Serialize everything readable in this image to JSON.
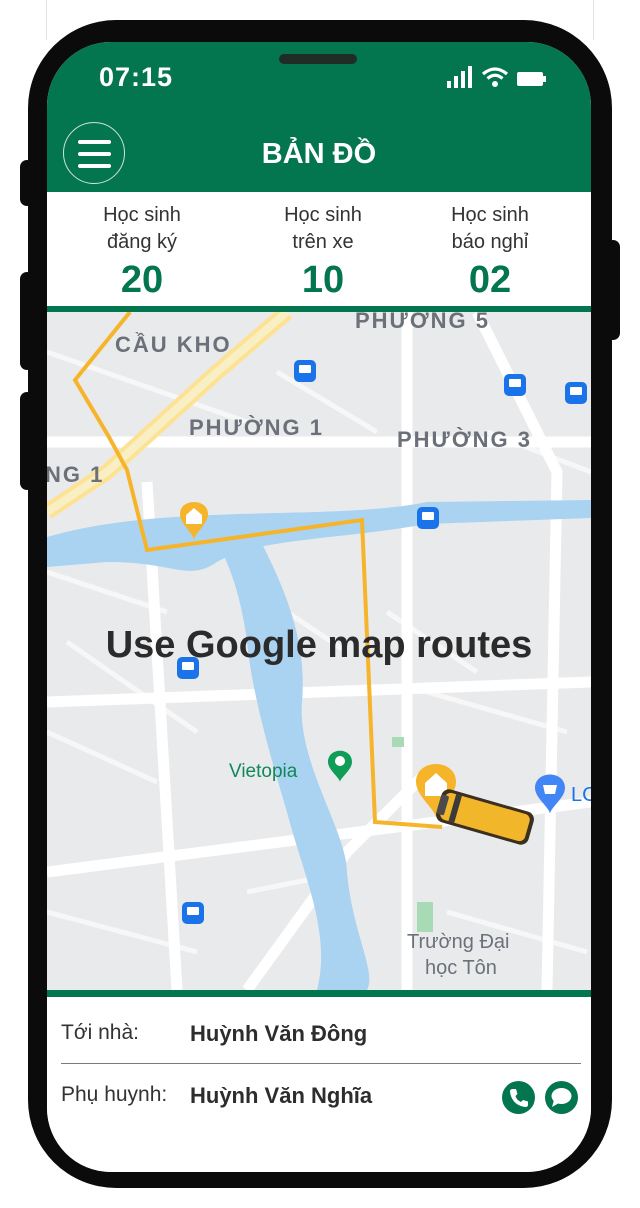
{
  "status_bar": {
    "time": "07:15"
  },
  "header": {
    "title": "BẢN ĐỒ",
    "menu_icon": "hamburger-menu-icon"
  },
  "stats": [
    {
      "label_line1": "Học sinh",
      "label_line2": "đăng ký",
      "value": "20"
    },
    {
      "label_line1": "Học sinh",
      "label_line2": "trên xe",
      "value": "10"
    },
    {
      "label_line1": "Học sinh",
      "label_line2": "báo nghỉ",
      "value": "02"
    }
  ],
  "map": {
    "overlay_text": "Use Google map routes",
    "labels": {
      "cau_kho": "CẦU KHO",
      "phuong_5": "PHƯỜNG 5",
      "phuong_1": "PHƯỜNG 1",
      "phuong_3": "PHƯỜNG 3",
      "ng_1": "NG 1",
      "vietopia": "Vietopia",
      "university_line1": "Trường Đại",
      "university_line2": "học Tôn",
      "lo": "LC"
    },
    "colors": {
      "route": "#f6b42a",
      "river": "#aad3f1",
      "road": "#ffffff",
      "brand": "#03754f"
    }
  },
  "trip": {
    "destination_label": "Tới nhà:",
    "destination_value": "Huỳnh Văn Đông",
    "parent_label": "Phụ huynh:",
    "parent_value": "Huỳnh Văn Nghĩa"
  }
}
